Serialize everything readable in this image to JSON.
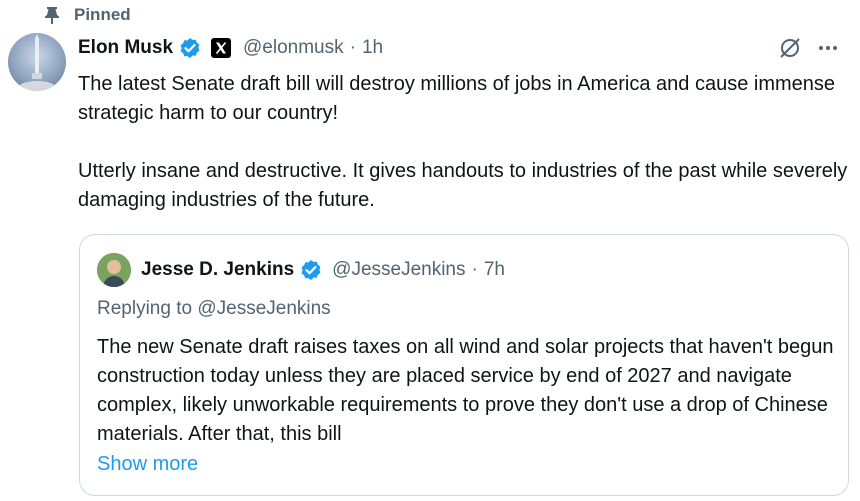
{
  "pinned_label": "Pinned",
  "tweet": {
    "author_name": "Elon Musk",
    "handle": "@elonmusk",
    "separator": "·",
    "time": "1h",
    "paragraphs": [
      "The latest Senate draft bill will destroy millions of jobs in America and cause immense strategic harm to our country!",
      "Utterly insane and destructive. It gives handouts to industries of the past while severely damaging industries of the future."
    ]
  },
  "quote": {
    "author_name": "Jesse D. Jenkins",
    "handle": "@JesseJenkins",
    "separator": "·",
    "time": "7h",
    "replying_to": "Replying to @JesseJenkins",
    "text": "The new Senate draft raises taxes on all wind and solar projects that haven't begun construction today unless they are placed service by end of 2027 and navigate complex, likely unworkable requirements to prove they don't use a drop of Chinese materials. After that, this bill",
    "show_more": "Show more"
  },
  "colors": {
    "accent": "#1d9bf0",
    "muted": "#536471",
    "border": "#cfd9de"
  },
  "icons": {
    "pin": "pin-icon",
    "verified": "verified-badge-icon",
    "affiliate": "x-logo-icon",
    "grok": "grok-icon",
    "more": "more-options-icon"
  }
}
